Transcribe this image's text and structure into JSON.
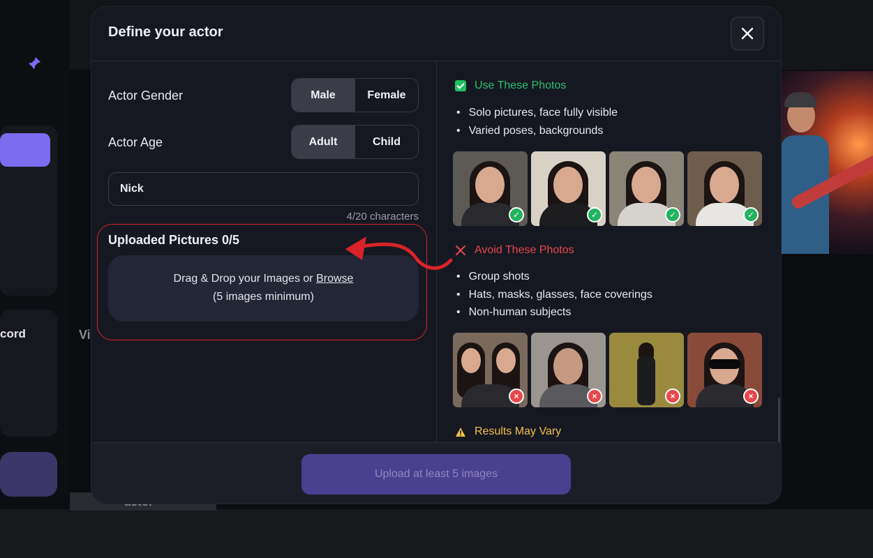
{
  "background": {
    "partial_label": "cord",
    "partial_label_2": "Vi",
    "thumb_label": "actor",
    "accent_color": "#7b6cf0"
  },
  "modal": {
    "title": "Define your actor",
    "close_icon": "close-icon",
    "gender": {
      "label": "Actor Gender",
      "options": [
        "Male",
        "Female"
      ],
      "selected": "Male"
    },
    "age": {
      "label": "Actor Age",
      "options": [
        "Adult",
        "Child"
      ],
      "selected": "Adult"
    },
    "name_input": {
      "value": "Nick",
      "counter": "4/20 characters"
    },
    "upload": {
      "title": "Uploaded Pictures 0/5",
      "drop_text": "Drag & Drop your Images or ",
      "browse_link": "Browse",
      "minimum_note": "(5 images minimum)"
    },
    "guidelines": {
      "use": {
        "heading": "Use These Photos",
        "bullets": [
          "Solo pictures, face fully visible",
          "Varied poses, backgrounds"
        ]
      },
      "avoid": {
        "heading": "Avoid These Photos",
        "bullets": [
          "Group shots",
          "Hats, masks, glasses, face coverings",
          "Non-human subjects"
        ]
      },
      "warning": {
        "heading": "Results May Vary"
      }
    },
    "submit_button": "Upload at least 5 images"
  },
  "colors": {
    "good": "#2fbf71",
    "bad": "#e5484d",
    "warn": "#f0c04a",
    "cta": "#4b3f8f",
    "annotation": "#d8232a"
  }
}
